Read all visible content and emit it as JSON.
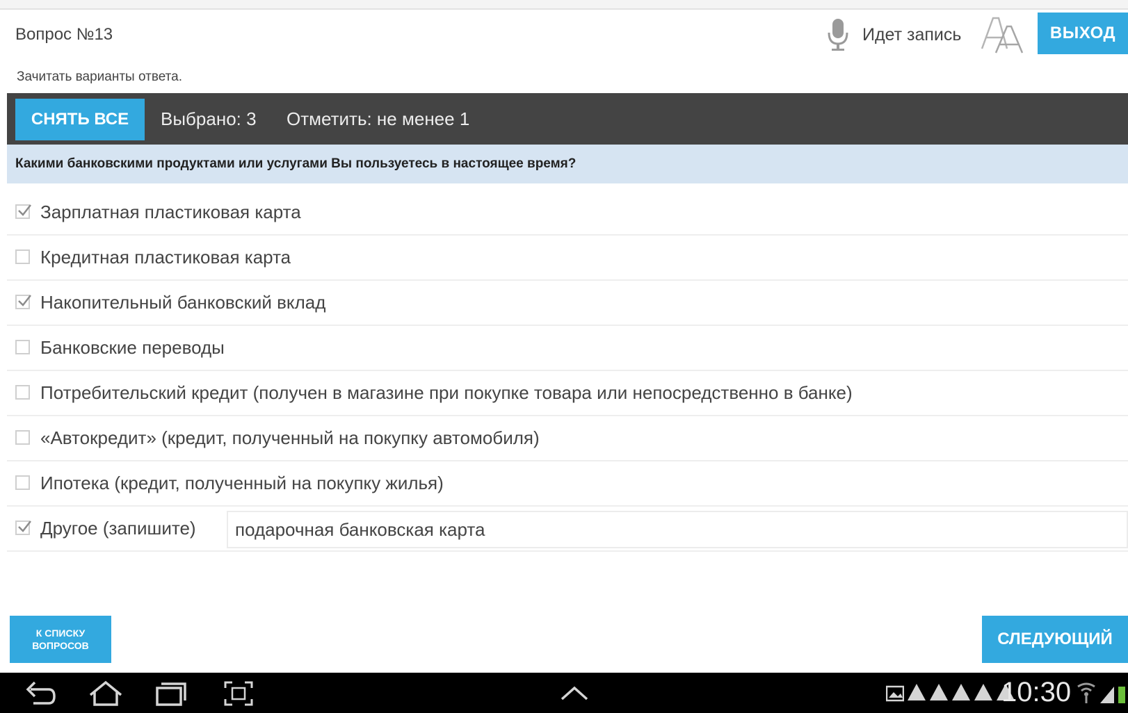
{
  "header": {
    "question_number": "Вопрос №13",
    "recording_label": "Идет запись",
    "exit_label": "ВЫХОД"
  },
  "instruction": "Зачитать варианты ответа.",
  "toolbar": {
    "clear_all_label": "СНЯТЬ ВСЕ",
    "selected_text": "Выбрано: 3",
    "mark_text": "Отметить: не менее 1"
  },
  "question_text": "Какими банковскими продуктами или услугами Вы пользуетесь в настоящее время?",
  "options": [
    {
      "label": "Зарплатная пластиковая карта",
      "checked": true
    },
    {
      "label": "Кредитная пластиковая карта",
      "checked": false
    },
    {
      "label": "Накопительный банковский вклад",
      "checked": true
    },
    {
      "label": "Банковские переводы",
      "checked": false
    },
    {
      "label": "Потребительский кредит (получен в магазине при покупке товара или непосредственно в банке)",
      "checked": false
    },
    {
      "label": "«Автокредит» (кредит, полученный на покупку автомобиля)",
      "checked": false
    },
    {
      "label": "Ипотека (кредит, полученный на покупку жилья)",
      "checked": false
    },
    {
      "label": "Другое (запишите)",
      "checked": true
    }
  ],
  "other_value": "подарочная банковская карта",
  "footer": {
    "back_label_line1": "К СПИСКУ",
    "back_label_line2": "ВОПРОСОВ",
    "next_label": "СЛЕДУЮЩИЙ"
  },
  "statusbar": {
    "time": "10:30"
  },
  "icons": [
    "microphone-icon",
    "font-size-icon",
    "back-icon",
    "home-icon",
    "recent-apps-icon",
    "screenshot-icon",
    "chevron-up-icon",
    "signal-icon",
    "wifi-icon",
    "battery-icon"
  ],
  "colors": {
    "accent": "#33a9df",
    "toolbar": "#444444",
    "question_bg": "#d6e4f2",
    "navbar": "#000000"
  }
}
